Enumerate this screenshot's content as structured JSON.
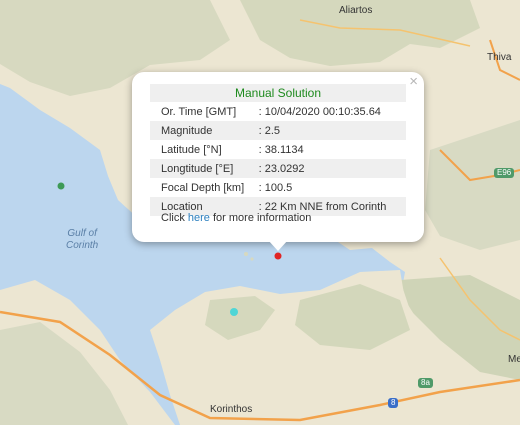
{
  "map": {
    "places": [
      "Aliartos",
      "Thiva",
      "Korinthos",
      "Me"
    ],
    "water": [
      "Gulf of",
      "Corinth"
    ],
    "shields": [
      "E96",
      "8a",
      "8"
    ],
    "colors": {
      "water": "#bcd6ee",
      "land": "#ece6d2",
      "terrain": "#d7d9c0",
      "road": "#f2a24b",
      "epicenter": "#e02424",
      "marker_green": "#3e9a56",
      "marker_cyan": "#4fd6d6"
    }
  },
  "markers": [
    {
      "name": "selected-epicenter",
      "color": "#e02424"
    },
    {
      "name": "earthquake-marker-green",
      "color": "#3e9a56"
    },
    {
      "name": "earthquake-marker-cyan",
      "color": "#4fd6d6"
    }
  ],
  "popup": {
    "close_label": "×",
    "title": "Manual Solution",
    "rows": [
      {
        "label": "Or. Time [GMT]",
        "value": ": 10/04/2020 00:10:35.64"
      },
      {
        "label": "Magnitude",
        "value": ": 2.5"
      },
      {
        "label": "Latitude [°N]",
        "value": ": 38.1134"
      },
      {
        "label": "Longtitude [°E]",
        "value": ": 23.0292"
      },
      {
        "label": "Focal Depth [km]",
        "value": ": 100.5"
      },
      {
        "label": "Location",
        "value": ": 22 Km NNE from Corinth"
      }
    ],
    "more_prefix": "Click ",
    "more_link": "here",
    "more_suffix": " for more information"
  }
}
